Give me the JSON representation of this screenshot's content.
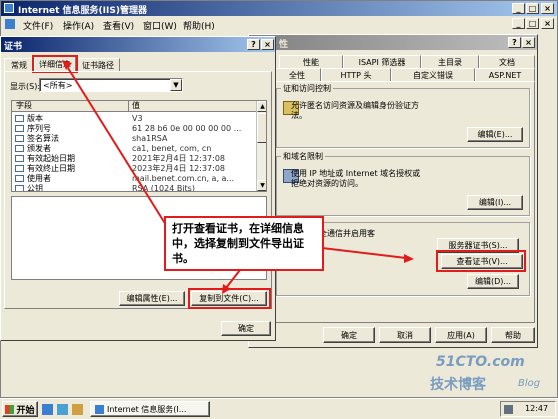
{
  "iis": {
    "title": "Internet 信息服务(IIS)管理器",
    "menu": [
      "文件(F)",
      "操作(A)",
      "查看(V)",
      "窗口(W)",
      "帮助(H)"
    ]
  },
  "props": {
    "title_fragment": "性",
    "tabs_row1": [
      "性能",
      "ISAPI 筛选器",
      "主目录",
      "文档"
    ],
    "tabs_row2": [
      "全性",
      "HTTP 头",
      "自定义错误",
      "ASP.NET"
    ],
    "group1": {
      "label": "证和访问控制",
      "desc": "允许匿名访问资源及编辑身份验证方\n法。",
      "button": "编辑(E)..."
    },
    "group2": {
      "label": "和域名限制",
      "desc": "使用 IP 地址或 Internet 域名授权或\n拒绝对资源的访问。",
      "button": "编辑(I)..."
    },
    "group3": {
      "desc": "，要求安全通信并启用客",
      "btn_server_cert": "服务器证书(S)...",
      "btn_view_cert": "查看证书(V)...",
      "btn_edit": "编辑(D)..."
    },
    "ok": "确定",
    "cancel": "取消",
    "apply": "应用(A)",
    "help": "帮助"
  },
  "cert": {
    "title": "证书",
    "tabs": [
      "常规",
      "详细信息",
      "证书路径"
    ],
    "show_label": "显示(S):",
    "show_value": "<所有>",
    "columns": [
      "字段",
      "值"
    ],
    "rows": [
      {
        "field": "版本",
        "value": "V3"
      },
      {
        "field": "序列号",
        "value": "61 28 b6 0e 00 00 00 00 ..."
      },
      {
        "field": "签名算法",
        "value": "sha1RSA"
      },
      {
        "field": "颁发者",
        "value": "ca1, benet, com, cn"
      },
      {
        "field": "有效起始日期",
        "value": "2021年2月4日 12:37:08"
      },
      {
        "field": "有效终止日期",
        "value": "2023年2月4日 12:37:08"
      },
      {
        "field": "使用者",
        "value": "mail.benet.com.cn, a, a..."
      },
      {
        "field": "公钥",
        "value": "RSA (1024 Bits)"
      }
    ],
    "edit_props": "编辑属性(E)...",
    "copy_to_file": "复制到文件(C)...",
    "ok": "确定"
  },
  "callout": {
    "text": "打开查看证书，在详细信息中，选择复制到文件导出证书。"
  },
  "taskbar": {
    "start": "开始",
    "task": "Internet 信息服务(I...",
    "time": "12:47"
  },
  "watermark": {
    "line1": "51CTO.com",
    "line2": "技术博客",
    "line3": "Blog"
  },
  "colors": {
    "title_active": "#0a246a",
    "title_inactive": "#808080",
    "desktop": "#3a6ea5",
    "face": "#ece9d8",
    "highlight_red": "#e21b1b"
  }
}
